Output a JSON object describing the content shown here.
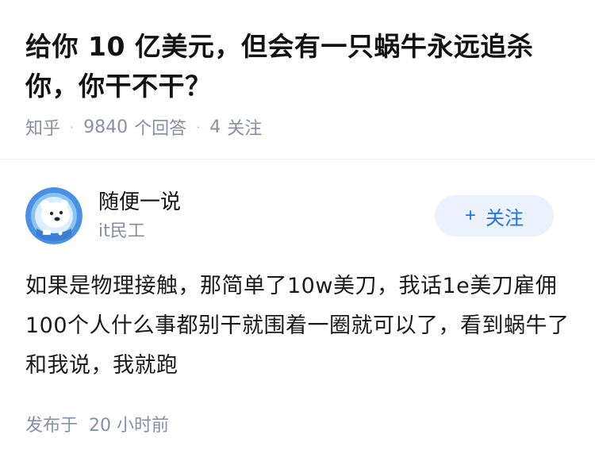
{
  "question": {
    "title": "给你 10 亿美元，但会有一只蜗牛永远追杀你，你干不干？",
    "source": "知乎",
    "answer_count": "9840",
    "answer_label": "个回答",
    "follower_count": "4",
    "follower_label": "关注",
    "separator": "·"
  },
  "answer": {
    "author_name": "随便一说",
    "author_desc": "it民工",
    "follow_label": "关注",
    "follow_prefix": "+",
    "content": "如果是物理接触，那简单了10w美刀，我话1e美刀雇佣100个人什么事都别干就围着一圈就可以了，看到蜗牛了和我说，我就跑",
    "published_prefix": "发布于",
    "published_time": "20 小时前"
  },
  "colors": {
    "muted": "#8590a6",
    "accent": "#1772f6",
    "follow_bg": "#ebf2fd",
    "avatar_bg": "#4a90e2"
  },
  "icons": {
    "avatar": "polar-bear-astronaut-avatar"
  }
}
